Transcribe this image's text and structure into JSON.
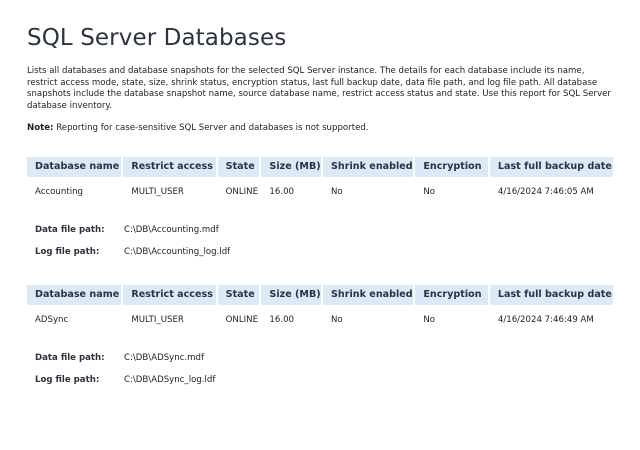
{
  "report": {
    "title": "SQL Server Databases",
    "description": "Lists all databases and database snapshots for the selected SQL Server instance. The details for each database include its name, restrict access mode, state, size, shrink status, encryption status, last full backup date, data file path, and log file path. All database snapshots include the database snapshot name, source database name, restrict access status and state. Use this report for SQL Server database inventory.",
    "note_label": "Note:",
    "note_text": " Reporting for case-sensitive SQL Server and databases is not supported."
  },
  "columns": [
    "Database name",
    "Restrict access",
    "State",
    "Size (MB)",
    "Shrink enabled",
    "Encryption",
    "Last full backup date"
  ],
  "path_labels": {
    "data": "Data file path:",
    "log": "Log file path:"
  },
  "databases": [
    {
      "name": "Accounting",
      "restrict_access": "MULTI_USER",
      "state": "ONLINE",
      "size_mb": "16.00",
      "shrink_enabled": "No",
      "encryption": "No",
      "last_full_backup": "4/16/2024 7:46:05 AM",
      "data_file_path": "C:\\DB\\Accounting.mdf",
      "log_file_path": "C:\\DB\\Accounting_log.ldf"
    },
    {
      "name": "ADSync",
      "restrict_access": "MULTI_USER",
      "state": "ONLINE",
      "size_mb": "16.00",
      "shrink_enabled": "No",
      "encryption": "No",
      "last_full_backup": "4/16/2024 7:46:49 AM",
      "data_file_path": "C:\\DB\\ADSync.mdf",
      "log_file_path": "C:\\DB\\ADSync_log.ldf"
    }
  ]
}
